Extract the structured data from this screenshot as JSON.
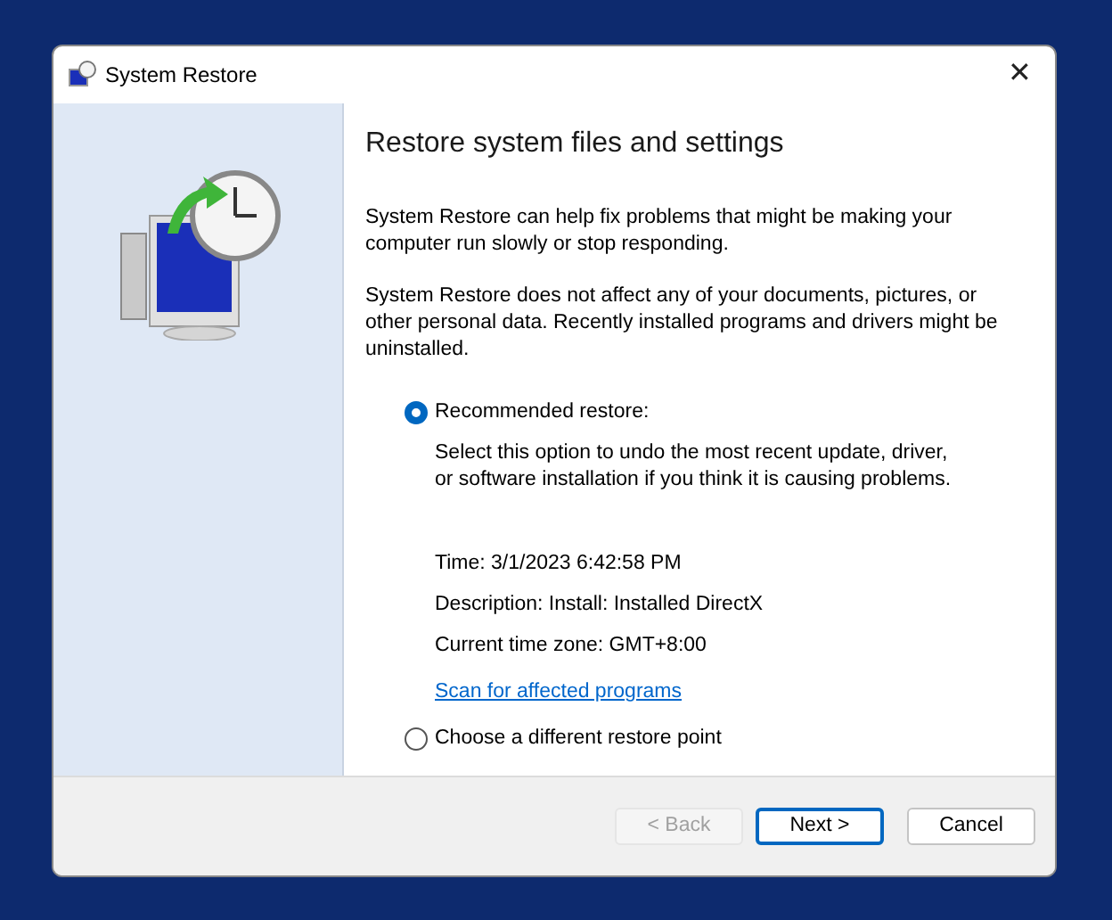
{
  "window": {
    "title": "System Restore",
    "close": "✕"
  },
  "heading": "Restore system files and settings",
  "paragraphs": [
    "System Restore can help fix problems that might be making your computer run slowly or stop responding.",
    "System Restore does not affect any of your documents, pictures, or other personal data. Recently installed programs and drivers might be uninstalled."
  ],
  "options": [
    {
      "label": "Recommended restore:",
      "selected": true,
      "description": "Select this option to undo the most recent update, driver, or software installation if you think it is causing problems.",
      "details": [
        "Time: 3/1/2023 6:42:58 PM",
        "Description: Install: Installed DirectX",
        "Current time zone: GMT+8:00"
      ],
      "link": "Scan for affected programs"
    },
    {
      "label": "Choose a different restore point",
      "selected": false
    }
  ],
  "buttons": [
    {
      "label": "< Back",
      "disabled": true,
      "default": false
    },
    {
      "label": "Next >",
      "disabled": false,
      "default": true
    },
    {
      "label": "Cancel",
      "disabled": false,
      "default": false
    }
  ]
}
